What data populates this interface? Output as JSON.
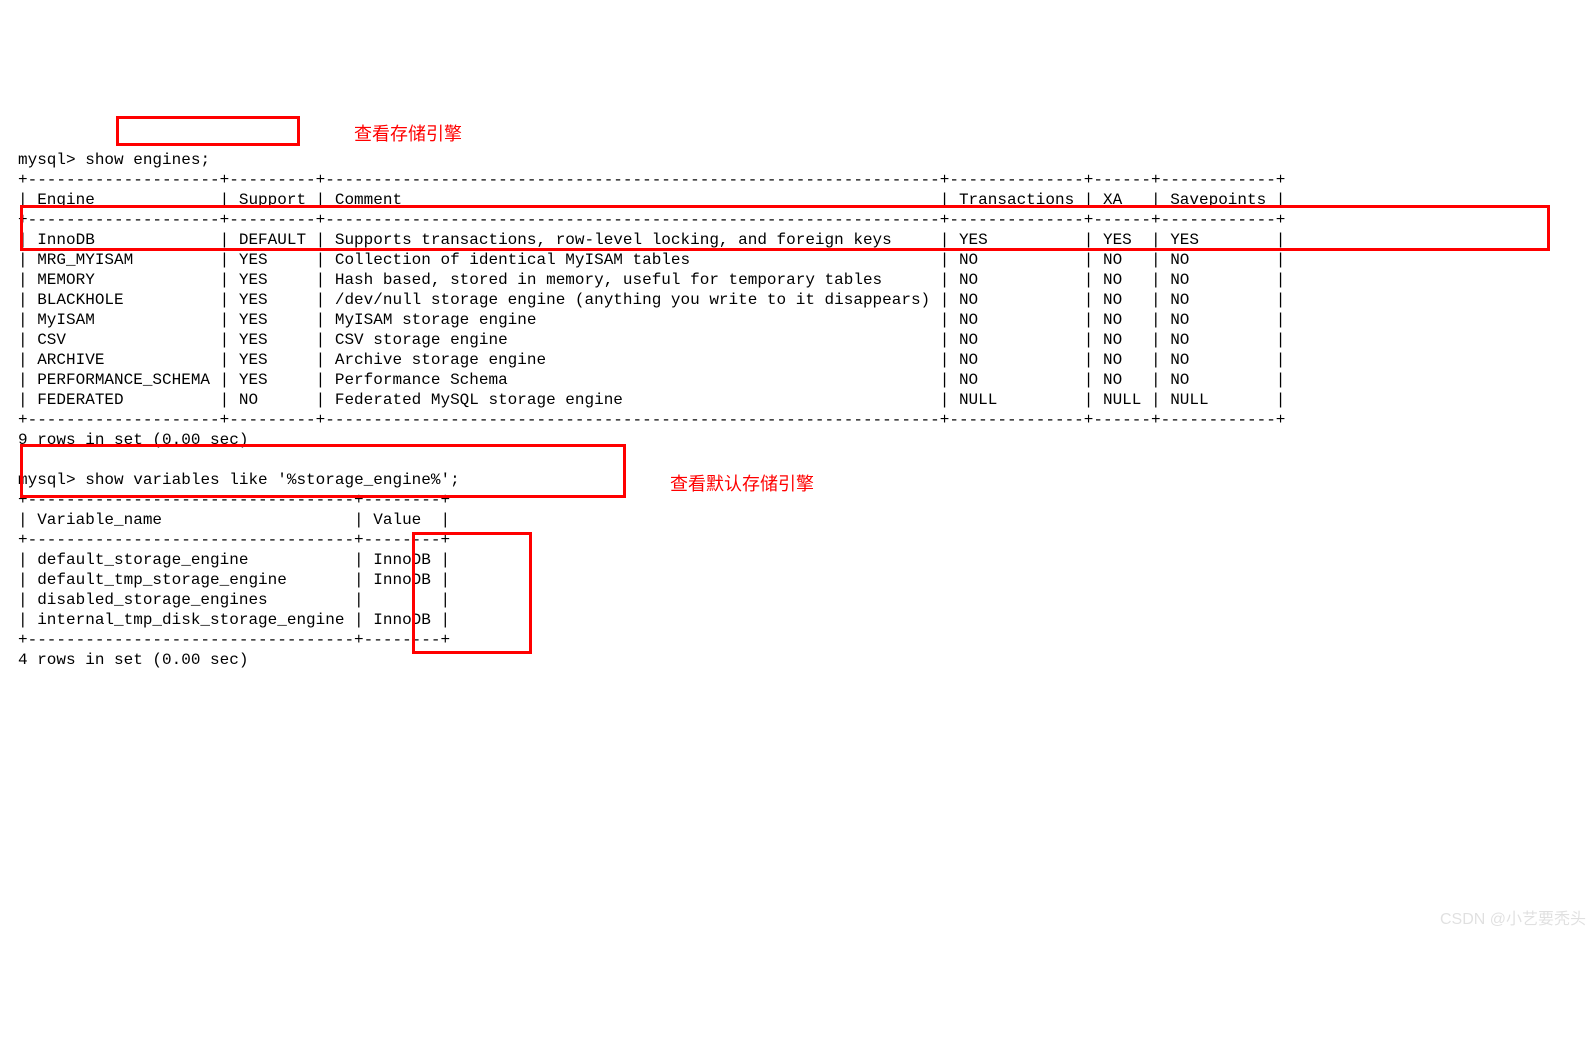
{
  "prompt1": "mysql> ",
  "cmd1": "show engines;",
  "annotation1": "查看存储引擎",
  "engines_header_line": "+--------------------+---------+----------------------------------------------------------------+--------------+------+------------+",
  "engines_header": "| Engine             | Support | Comment                                                        | Transactions | XA   | Savepoints |",
  "engines_rows": [
    "| InnoDB             | DEFAULT | Supports transactions, row-level locking, and foreign keys     | YES          | YES  | YES        |",
    "| MRG_MYISAM         | YES     | Collection of identical MyISAM tables                          | NO           | NO   | NO         |",
    "| MEMORY             | YES     | Hash based, stored in memory, useful for temporary tables      | NO           | NO   | NO         |",
    "| BLACKHOLE          | YES     | /dev/null storage engine (anything you write to it disappears) | NO           | NO   | NO         |",
    "| MyISAM             | YES     | MyISAM storage engine                                          | NO           | NO   | NO         |",
    "| CSV                | YES     | CSV storage engine                                             | NO           | NO   | NO         |",
    "| ARCHIVE            | YES     | Archive storage engine                                         | NO           | NO   | NO         |",
    "| PERFORMANCE_SCHEMA | YES     | Performance Schema                                             | NO           | NO   | NO         |",
    "| FEDERATED          | NO      | Federated MySQL storage engine                                 | NULL         | NULL | NULL       |"
  ],
  "engines_footer": "9 rows in set (0.00 sec)",
  "prompt2": "mysql> ",
  "cmd2": "show variables like '%storage_engine%';",
  "annotation2": "查看默认存储引擎",
  "vars_header_line": "+----------------------------------+--------+",
  "vars_header": "| Variable_name                    | Value  |",
  "vars_rows": [
    "| default_storage_engine           | InnoDB |",
    "| default_tmp_storage_engine       | InnoDB |",
    "| disabled_storage_engines         |        |",
    "| internal_tmp_disk_storage_engine | InnoDB |"
  ],
  "vars_footer": "4 rows in set (0.00 sec)",
  "watermark": "CSDN @小艺要秃头"
}
